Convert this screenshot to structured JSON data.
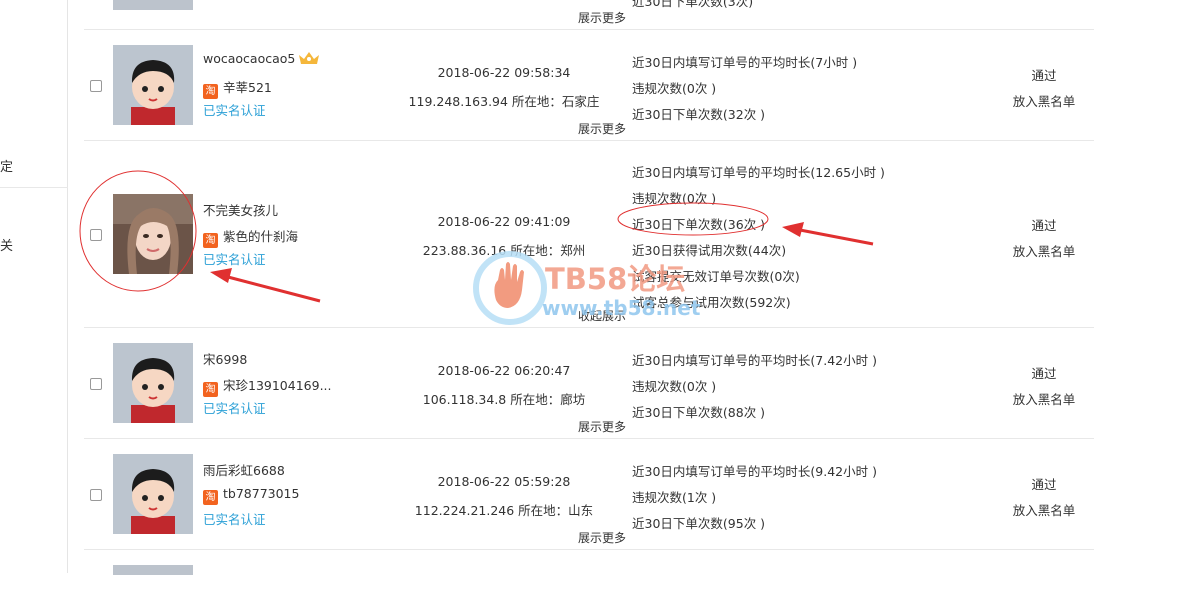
{
  "sidebar": {
    "items": [
      "定",
      "关"
    ]
  },
  "top_partial": {
    "stat": "近30日下单次数(3次)",
    "more": "展示更多"
  },
  "rows": [
    {
      "nickname": "wocaocaocao5",
      "shop": "辛莘521",
      "verified": "已实名认证",
      "time": "2018-06-22 09:58:34",
      "ip": "119.248.163.94 所在地：石家庄",
      "stats": [
        "近30日内填写订单号的平均时长(7小时 )",
        "违规次数(0次 )",
        "近30日下单次数(32次 )"
      ],
      "more": "展示更多",
      "approve": "通过",
      "blacklist": "放入黑名单"
    },
    {
      "nickname": "不完美女孩儿",
      "shop": "紫色的什刹海",
      "verified": "已实名认证",
      "time": "2018-06-22 09:41:09",
      "ip": "223.88.36.16 所在地：郑州",
      "stats": [
        "近30日内填写订单号的平均时长(12.65小时 )",
        "违规次数(0次 )",
        "近30日下单次数(36次 )",
        "近30日获得试用次数(44次)",
        "试客提交无效订单号次数(0次)",
        "试客总参与试用次数(592次)"
      ],
      "more": "收起展示",
      "approve": "通过",
      "blacklist": "放入黑名单"
    },
    {
      "nickname": "宋6998",
      "shop": "宋珍139104169...",
      "verified": "已实名认证",
      "time": "2018-06-22 06:20:47",
      "ip": "106.118.34.8 所在地：廊坊",
      "stats": [
        "近30日内填写订单号的平均时长(7.42小时 )",
        "违规次数(0次 )",
        "近30日下单次数(88次 )"
      ],
      "more": "展示更多",
      "approve": "通过",
      "blacklist": "放入黑名单"
    },
    {
      "nickname": "雨后彩虹6688",
      "shop": "tb78773015",
      "verified": "已实名认证",
      "time": "2018-06-22 05:59:28",
      "ip": "112.224.21.246 所在地：山东",
      "stats": [
        "近30日内填写订单号的平均时长(9.42小时 )",
        "违规次数(1次 )",
        "近30日下单次数(95次 )"
      ],
      "more": "展示更多",
      "approve": "通过",
      "blacklist": "放入黑名单"
    }
  ],
  "tao_badge": "淘",
  "watermark": {
    "title": "TB58论坛",
    "url": "www.tb58.net"
  },
  "colors": {
    "verified": "#2a9fd6",
    "tao": "#f2631f",
    "annotation": "#e03030"
  }
}
